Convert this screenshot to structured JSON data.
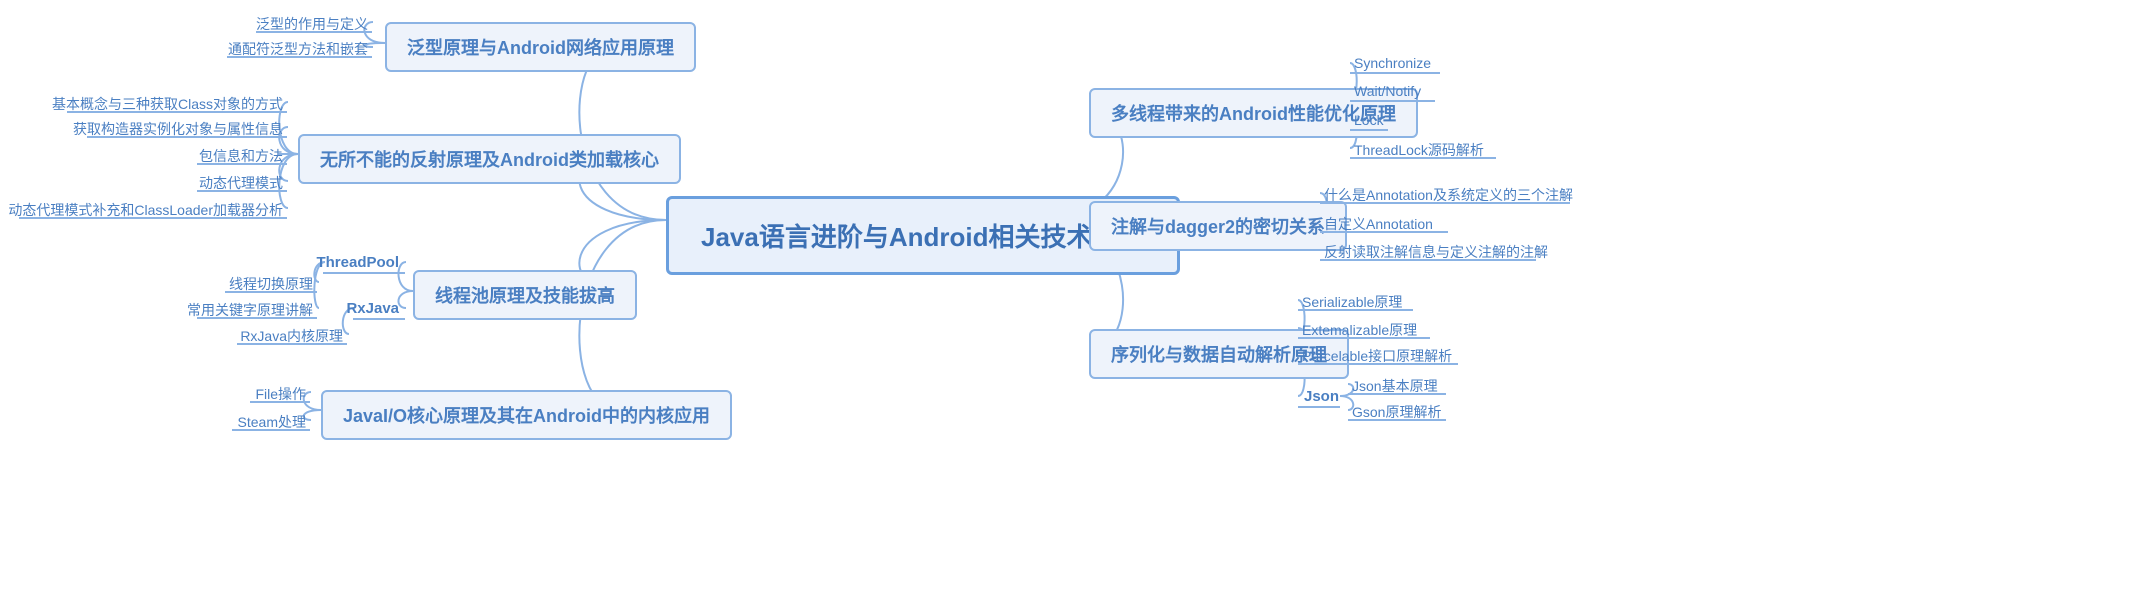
{
  "root": "Java语言进阶与Android相关技术内核",
  "left": [
    {
      "title": "泛型原理与Android网络应用原理",
      "leaves": [
        "泛型的作用与定义",
        "通配符泛型方法和嵌套"
      ]
    },
    {
      "title": "无所不能的反射原理及Android类加载核心",
      "leaves": [
        "基本概念与三种获取Class对象的方式",
        "获取构造器实例化对象与属性信息",
        "包信息和方法",
        "动态代理模式",
        "动态代理模式补充和ClassLoader加载器分析"
      ]
    },
    {
      "title": "线程池原理及技能拔高",
      "sub": [
        {
          "label": "ThreadPool",
          "leaves": [
            "线程切换原理",
            "常用关键字原理讲解"
          ]
        },
        {
          "label": "RxJava",
          "leaves": [
            "RxJava内核原理"
          ]
        }
      ]
    },
    {
      "title": "JavaI/O核心原理及其在Android中的内核应用",
      "leaves": [
        "File操作",
        "Steam处理"
      ]
    }
  ],
  "right": [
    {
      "title": "多线程带来的Android性能优化原理",
      "leaves": [
        "Synchronize",
        "Wait/Notify",
        "Lock",
        "ThreadLock源码解析"
      ]
    },
    {
      "title": "注解与dagger2的密切关系",
      "leaves": [
        "什么是Annotation及系统定义的三个注解",
        "自定义Annotation",
        "反射读取注解信息与定义注解的注解"
      ]
    },
    {
      "title": "序列化与数据自动解析原理",
      "plain": [
        "Serializable原理",
        "Extemalizable原理",
        "Parcelable接口原理解析"
      ],
      "sub": [
        {
          "label": "Json",
          "leaves": [
            "Json基本原理",
            "Gson原理解析"
          ]
        }
      ]
    }
  ]
}
